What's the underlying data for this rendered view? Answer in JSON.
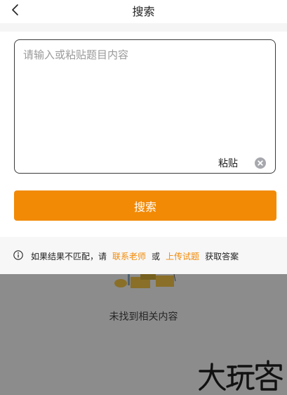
{
  "header": {
    "title": "搜索",
    "back_icon": "chevron-left-icon"
  },
  "search_box": {
    "placeholder": "请输入或粘贴题目内容",
    "value": "",
    "paste_label": "粘贴",
    "clear_icon": "clear-circle-icon"
  },
  "search_button": {
    "label": "搜索"
  },
  "info": {
    "icon": "info-circle-icon",
    "prefix": "如果结果不匹配，请",
    "contact_link": "联系老师",
    "or_text": "或",
    "upload_link": "上传试题",
    "suffix": "获取答案"
  },
  "empty_state": {
    "text": "未找到相关内容"
  },
  "watermark": {
    "text": "大玩客"
  },
  "colors": {
    "accent": "#f28a05",
    "overlay": "#8c8c8c"
  }
}
